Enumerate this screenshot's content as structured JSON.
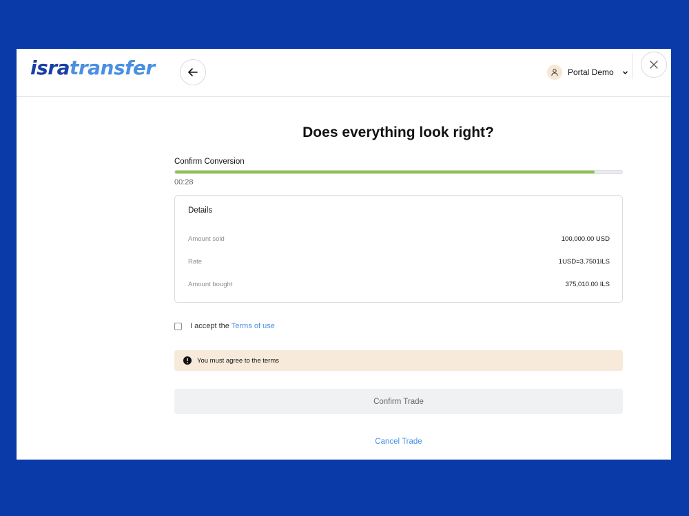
{
  "header": {
    "logo_part1": "isra",
    "logo_part2": "transfer",
    "user_name": "Portal Demo"
  },
  "main": {
    "title": "Does everything look right?",
    "progress": {
      "label": "Confirm Conversion",
      "fill_fraction": 0.938,
      "timer": "00:28",
      "color": "#8bc34a"
    },
    "details": {
      "title": "Details",
      "rows": [
        {
          "label": "Amount sold",
          "value": "100,000.00 USD"
        },
        {
          "label": "Rate",
          "value": "1USD=3.7501ILS"
        },
        {
          "label": "Amount bought",
          "value": "375,010.00 ILS"
        }
      ]
    },
    "terms": {
      "prefix": "I accept the",
      "link": "Terms of use",
      "checked": false
    },
    "alert": {
      "message": "You must agree to the terms",
      "icon": "exclamation-circle-icon"
    },
    "confirm_label": "Confirm Trade",
    "cancel_label": "Cancel Trade"
  },
  "colors": {
    "background": "#0a3aa8",
    "accent": "#4a90e2",
    "brand_dark": "#1a3fa6",
    "alert_bg": "#f8eadb"
  }
}
